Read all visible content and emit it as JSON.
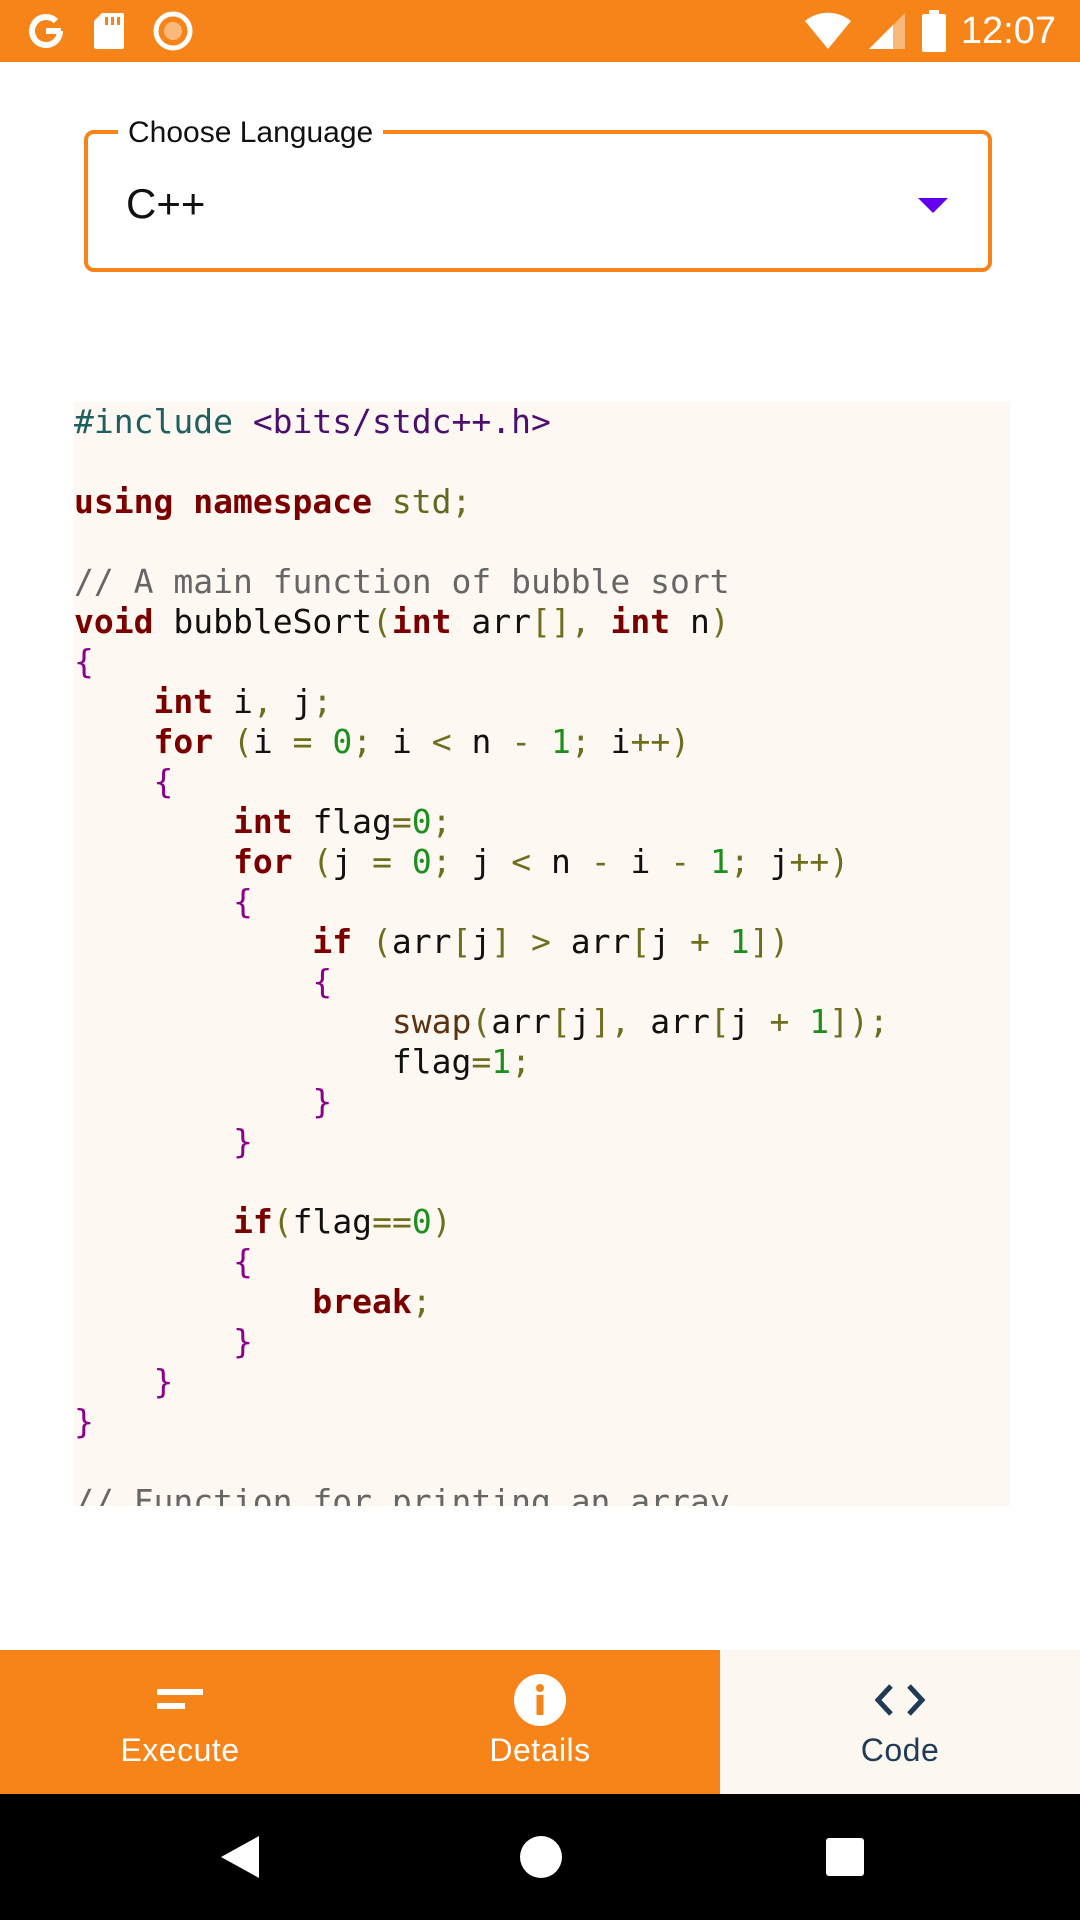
{
  "status_bar": {
    "time": "12:07",
    "icons_left": [
      "google-icon",
      "sd-card-icon",
      "record-icon"
    ],
    "icons_right": [
      "wifi-icon",
      "signal-icon",
      "battery-icon"
    ]
  },
  "language_select": {
    "label": "Choose Language",
    "value": "C++"
  },
  "bottom_nav": {
    "items": [
      {
        "label": "Execute",
        "icon": "execute-icon",
        "active": false
      },
      {
        "label": "Details",
        "icon": "info-icon",
        "active": false
      },
      {
        "label": "Code",
        "icon": "code-icon",
        "active": true
      }
    ]
  },
  "colors": {
    "accent": "#f78418",
    "code_background": "#fdf8f2",
    "caret": "#6200ee",
    "active_nav_text": "#1f3b55"
  },
  "code": {
    "language": "C++",
    "lines": [
      "#include <bits/stdc++.h>",
      "",
      "using namespace std;",
      "",
      "// A main function of bubble sort",
      "void bubbleSort(int arr[], int n)",
      "{",
      "    int i, j;",
      "    for (i = 0; i < n - 1; i++)",
      "    {",
      "        int flag=0;",
      "        for (j = 0; j < n - i - 1; j++)",
      "        {",
      "            if (arr[j] > arr[j + 1])",
      "            {",
      "                swap(arr[j], arr[j + 1]);",
      "                flag=1;",
      "            }",
      "        }",
      "",
      "        if(flag==0)",
      "        {",
      "            break;",
      "        }",
      "    }",
      "}",
      "",
      "// Function for printing an array"
    ]
  },
  "system_nav": {
    "buttons": [
      "back-icon",
      "home-icon",
      "recents-icon"
    ]
  }
}
